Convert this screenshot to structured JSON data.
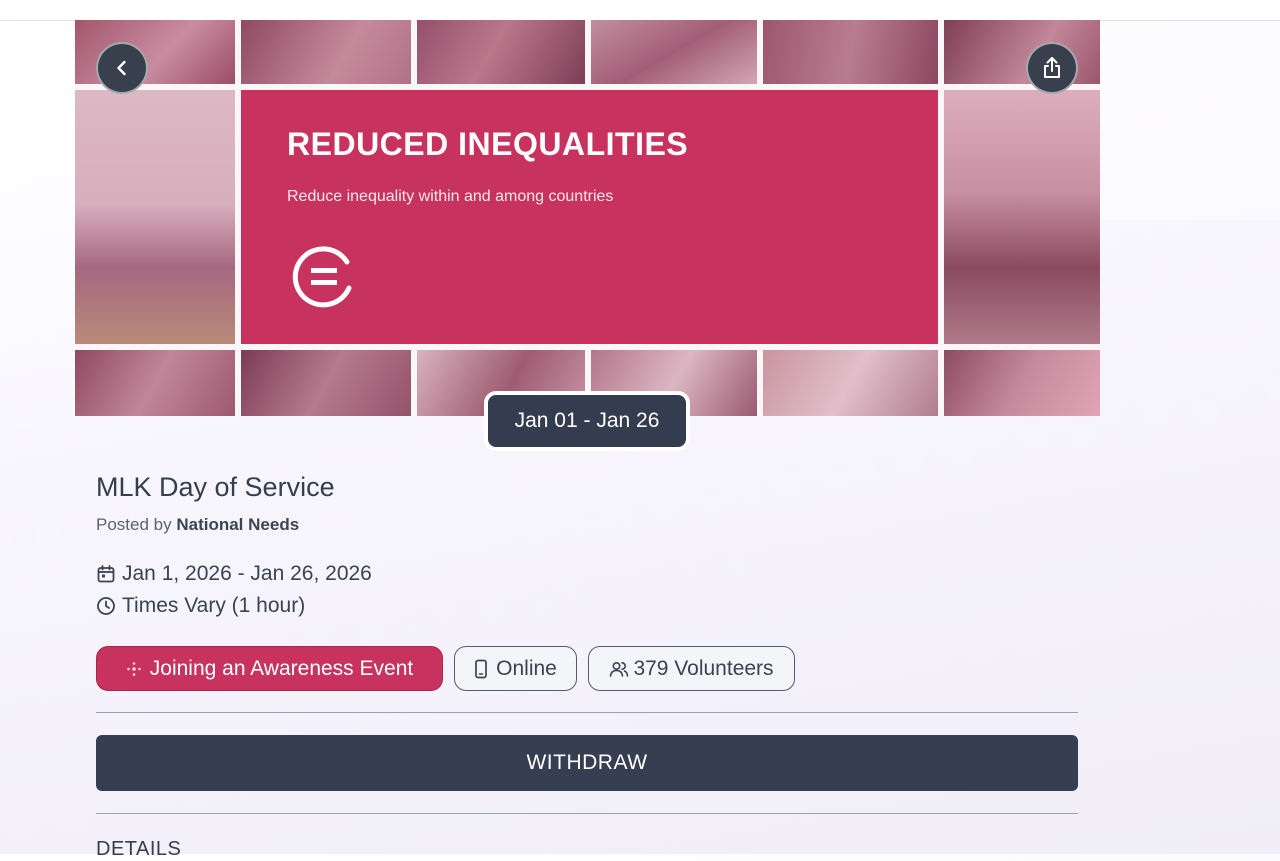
{
  "hero": {
    "banner_title": "REDUCED INEQUALITIES",
    "banner_subtitle": "Reduce inequality within and among countries",
    "date_range_badge": "Jan 01 - Jan 26"
  },
  "event": {
    "title": "MLK Day of Service",
    "posted_by_prefix": "Posted by",
    "posted_by_org": "National Needs",
    "date_range": "Jan 1, 2026 - Jan 26, 2026",
    "time": "Times Vary (1 hour)"
  },
  "chips": {
    "cause": "Joining an Awareness Event",
    "location": "Online",
    "volunteers": "379 Volunteers"
  },
  "actions": {
    "withdraw_label": "WITHDRAW"
  },
  "sections": {
    "details_heading": "DETAILS"
  },
  "icons": {
    "back": "chevron-left-icon",
    "share": "share-icon",
    "calendar": "calendar-icon",
    "clock": "clock-icon",
    "cause": "awareness-icon",
    "device": "phone-icon",
    "people": "users-icon"
  },
  "colors": {
    "cause_pink": "#c8325f",
    "dark_navy": "#353f51",
    "text": "#333e4f"
  }
}
